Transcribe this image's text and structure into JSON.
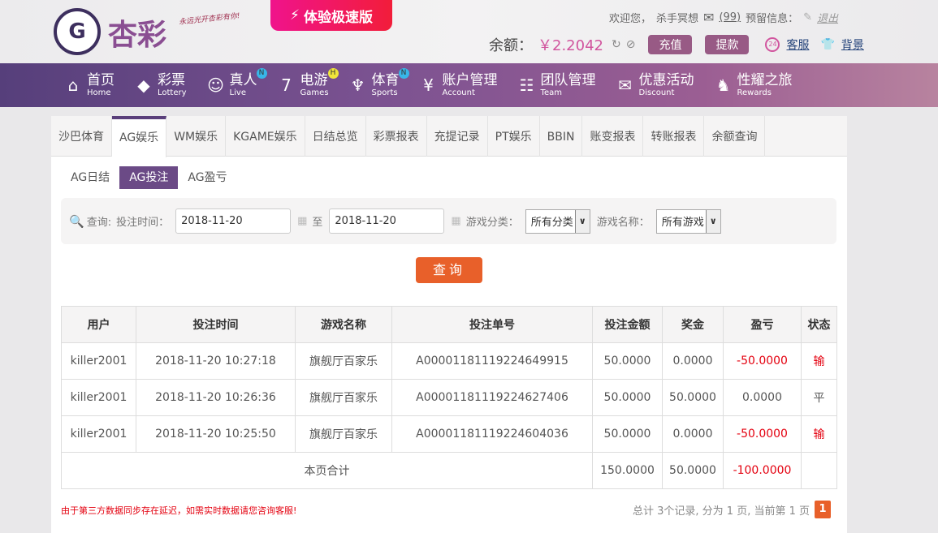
{
  "header": {
    "logo_text": "杏彩",
    "slogan": "永远光开杏彩有你!",
    "promo": "体验极速版",
    "welcome": "欢迎您，",
    "username": "杀手冥想",
    "messages": "(99)",
    "reserved_info": "预留信息：",
    "logout": "退出",
    "balance_label": "余额：",
    "balance_value": "￥2.2042",
    "deposit": "充值",
    "withdraw": "提款",
    "service": "客服",
    "background": "背景",
    "service_badge": "24"
  },
  "nav": [
    {
      "cn": "首页",
      "en": "Home",
      "icon": "⌂"
    },
    {
      "cn": "彩票",
      "en": "Lottery",
      "icon": "◆"
    },
    {
      "cn": "真人",
      "en": "Live",
      "icon": "☺",
      "badge": "N"
    },
    {
      "cn": "电游",
      "en": "Games",
      "icon": "7",
      "badge": "H"
    },
    {
      "cn": "体育",
      "en": "Sports",
      "icon": "♆",
      "badge": "N"
    },
    {
      "cn": "账户管理",
      "en": "Account",
      "icon": "¥"
    },
    {
      "cn": "团队管理",
      "en": "Team",
      "icon": "☷"
    },
    {
      "cn": "优惠活动",
      "en": "Discount",
      "icon": "✉"
    },
    {
      "cn": "性耀之旅",
      "en": "Rewards",
      "icon": "♞"
    }
  ],
  "tabs": [
    "沙巴体育",
    "AG娱乐",
    "WM娱乐",
    "KGAME娱乐",
    "日结总览",
    "彩票报表",
    "充提记录",
    "PT娱乐",
    "BBIN",
    "账变报表",
    "转账报表",
    "余额查询"
  ],
  "subtabs": [
    "AG日结",
    "AG投注",
    "AG盈亏"
  ],
  "filter": {
    "query": "查询:",
    "bet_time": "投注时间：",
    "from": "2018-11-20",
    "to_label": "至",
    "to": "2018-11-20",
    "category_label": "游戏分类：",
    "category": "所有分类",
    "game_label": "游戏名称：",
    "game": "所有游戏",
    "search": "查询"
  },
  "table": {
    "headers": [
      "用户",
      "投注时间",
      "游戏名称",
      "投注单号",
      "投注金额",
      "奖金",
      "盈亏",
      "状态"
    ],
    "rows": [
      [
        "killer2001",
        "2018-11-20 10:27:18",
        "旗舰厅百家乐",
        "A00001181119224649915",
        "50.0000",
        "0.0000",
        "-50.0000",
        "输"
      ],
      [
        "killer2001",
        "2018-11-20 10:26:36",
        "旗舰厅百家乐",
        "A00001181119224627406",
        "50.0000",
        "50.0000",
        "0.0000",
        "平"
      ],
      [
        "killer2001",
        "2018-11-20 10:25:50",
        "旗舰厅百家乐",
        "A00001181119224604036",
        "50.0000",
        "0.0000",
        "-50.0000",
        "输"
      ]
    ],
    "total_label": "本页合计",
    "total": [
      "150.0000",
      "50.0000",
      "-100.0000"
    ]
  },
  "notice": "由于第三方数据同步存在延迟，如需实时数据请您咨询客服!",
  "pager": {
    "summary": "总计 3个记录, 分为 1 页, 当前第 1 页",
    "current": "1"
  }
}
